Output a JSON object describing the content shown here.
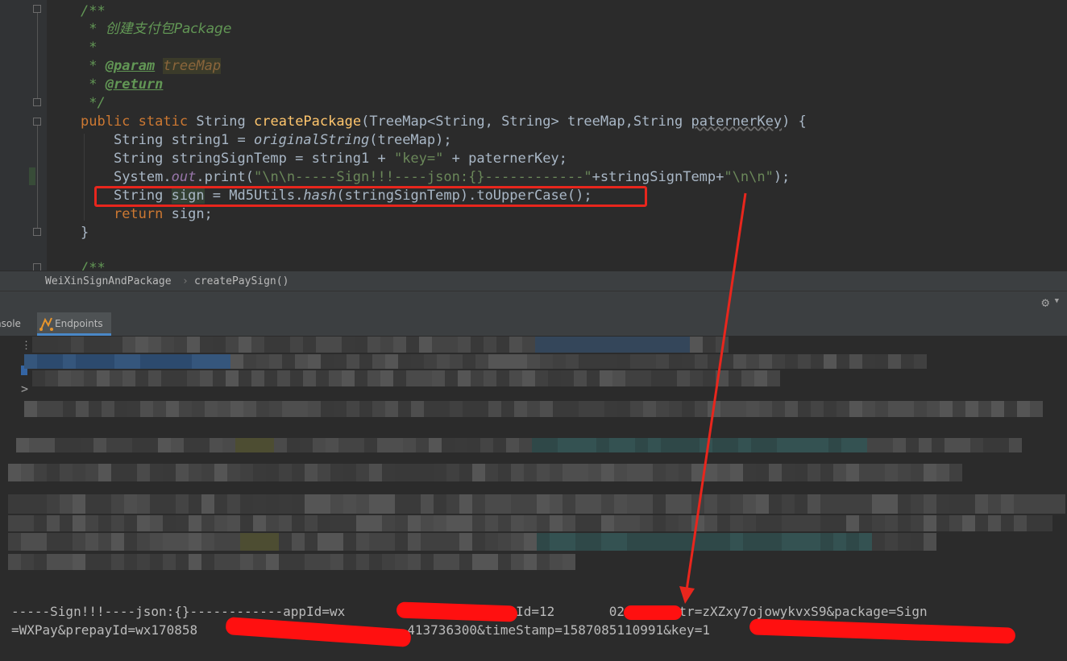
{
  "editor": {
    "javadoc_open": "/**",
    "javadoc_desc": "创建支付包Package",
    "javadoc_star": "*",
    "javadoc_param_tag": "@param",
    "javadoc_param_name": "treeMap",
    "javadoc_return_tag": "@return",
    "javadoc_close": "*/",
    "sig": {
      "kw_public": "public",
      "kw_static": "static",
      "ret_type": "String",
      "method_name": "createPackage",
      "params": "(TreeMap<String, String> treeMap,String ",
      "param2": "paternerKey",
      "tail": ") {"
    },
    "line1": {
      "pre": "String string1 = ",
      "call": "originalString",
      "post": "(treeMap);"
    },
    "line2": {
      "pre": "String stringSignTemp = string1 + ",
      "str": "\"key=\"",
      "post": " + paternerKey;"
    },
    "line3": {
      "pre": "System.",
      "field": "out",
      "mid": ".print(",
      "str1": "\"\\n\\n-----Sign!!!----json:{}------------\"",
      "mid2": "+stringSignTemp+",
      "str2": "\"\\n\\n\"",
      "post": ");"
    },
    "line4": {
      "pre": "String ",
      "var": "sign",
      "mid": " = Md5Utils.",
      "call": "hash",
      "post": "(stringSignTemp).toUpperCase();"
    },
    "line5": {
      "kw": "return",
      "post": " sign;"
    },
    "close_brace": "}",
    "next_javadoc": "/**"
  },
  "breadcrumb": {
    "class_name": "WeiXinSignAndPackage",
    "separator": "›",
    "method_name": "createPaySign()"
  },
  "tabs": {
    "console": "nsole",
    "endpoints": "Endpoints"
  },
  "console": {
    "prompt_symbols": [
      ">",
      ">"
    ],
    "output_line1": "-----Sign!!!----json:{}------------appId=wx                af&mchId=12       02&nonceStr=zXZxy7ojowykvxS9&package=Sign",
    "output_line2": "=WXPay&prepayId=wx170858                           413736300&timeStamp=1587085110991&key=1                          l"
  },
  "colors": {
    "annotation_red": "#e8261d",
    "editor_bg": "#2b2b2b",
    "panel_bg": "#3c3f41"
  }
}
